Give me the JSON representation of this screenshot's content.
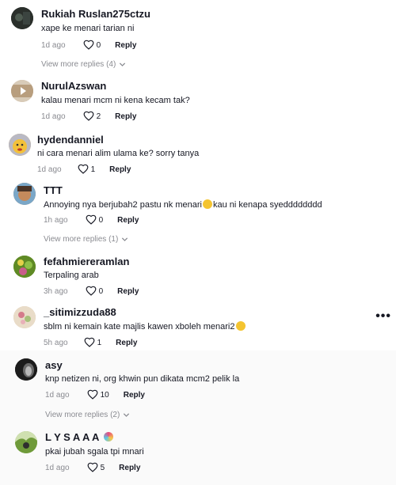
{
  "comments": [
    {
      "user": "Rukiah Ruslan275ctzu",
      "text": "xape ke menari tarian ni",
      "time": "1d ago",
      "likes": "0",
      "reply": "Reply",
      "view_more": "View more replies (4)",
      "avatar_color": "#2a2f2b"
    },
    {
      "user": "NurulAzswan",
      "text": "kalau menari mcm ni kena kecam tak?",
      "time": "1d ago",
      "likes": "2",
      "reply": "Reply",
      "avatar_color": "#c8b49a"
    },
    {
      "user": "hydendanniel",
      "text": "ni cara menari alim ulama ke? sorry tanya",
      "time": "1d ago",
      "likes": "1",
      "reply": "Reply",
      "avatar_color": "#e8b24a"
    },
    {
      "user": "TTT",
      "text_before": "Annoying nya berjubah2 pastu nk menari",
      "text_after": "kau ni kenapa syedddddddd",
      "time": "1h ago",
      "likes": "0",
      "reply": "Reply",
      "view_more": "View more replies (1)",
      "avatar_color": "#b57a4a"
    },
    {
      "user": "fefahmiereramlan",
      "text": "Terpaling arab",
      "time": "3h ago",
      "likes": "0",
      "reply": "Reply",
      "avatar_color": "#6f9a2e"
    },
    {
      "user": "_sitimizzuda88",
      "text": "sblm ni kemain kate majlis kawen xboleh menari2",
      "time": "5h ago",
      "likes": "1",
      "reply": "Reply",
      "avatar_color": "#d9c3a8"
    },
    {
      "user": "asy",
      "text": "knp netizen ni, org khwin pun dikata mcm2 pelik la",
      "time": "1d ago",
      "likes": "10",
      "reply": "Reply",
      "view_more": "View more replies (2)",
      "avatar_color": "#1c1c1c"
    },
    {
      "user": "L Y S A A A",
      "text": "pkai jubah sgala tpi mnari",
      "time": "1d ago",
      "likes": "5",
      "reply": "Reply",
      "avatar_color": "#8ab04a"
    }
  ],
  "more_options": "•••",
  "colors": {
    "text": "#161823",
    "muted": "#8a8b91",
    "emoji": "#f4c430"
  }
}
